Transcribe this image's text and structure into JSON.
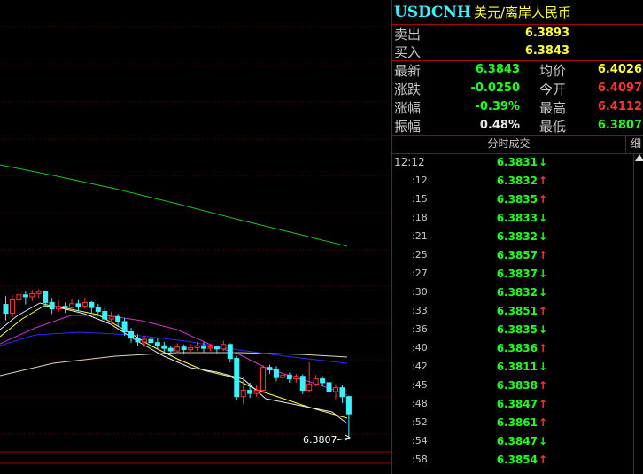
{
  "symbol": "USDCNH",
  "name": "美元/离岸人民币",
  "quote": {
    "sell_label": "卖出",
    "sell_value": "6.3893",
    "buy_label": "买入",
    "buy_value": "6.3843",
    "latest_label": "最新",
    "latest_value": "6.3843",
    "avg_label": "均价",
    "avg_value": "6.4026",
    "change_label": "涨跌",
    "change_value": "-0.0250",
    "open_label": "今开",
    "open_value": "6.4097",
    "pct_label": "涨幅",
    "pct_value": "-0.39%",
    "high_label": "最高",
    "high_value": "6.4112",
    "amp_label": "振幅",
    "amp_value": "0.48%",
    "low_label": "最低",
    "low_value": "6.3807"
  },
  "tabs": {
    "main": "分时成交",
    "side": "细"
  },
  "ticks": [
    {
      "time": "12:12",
      "price": "6.3831",
      "dir": "down"
    },
    {
      "time": ":12",
      "price": "6.3832",
      "dir": "up"
    },
    {
      "time": ":15",
      "price": "6.3835",
      "dir": "up"
    },
    {
      "time": ":18",
      "price": "6.3833",
      "dir": "down"
    },
    {
      "time": ":21",
      "price": "6.3832",
      "dir": "down"
    },
    {
      "time": ":25",
      "price": "6.3857",
      "dir": "up"
    },
    {
      "time": ":27",
      "price": "6.3837",
      "dir": "down"
    },
    {
      "time": ":30",
      "price": "6.3832",
      "dir": "down"
    },
    {
      "time": ":33",
      "price": "6.3851",
      "dir": "up"
    },
    {
      "time": ":36",
      "price": "6.3835",
      "dir": "down"
    },
    {
      "time": ":40",
      "price": "6.3836",
      "dir": "up"
    },
    {
      "time": ":42",
      "price": "6.3811",
      "dir": "down"
    },
    {
      "time": ":45",
      "price": "6.3838",
      "dir": "up"
    },
    {
      "time": ":48",
      "price": "6.3847",
      "dir": "up"
    },
    {
      "time": ":52",
      "price": "6.3861",
      "dir": "up"
    },
    {
      "time": ":54",
      "price": "6.3847",
      "dir": "down"
    },
    {
      "time": ":58",
      "price": "6.3854",
      "dir": "up"
    }
  ],
  "chart": {
    "last_label": "6.3807",
    "colors": {
      "up": "#ff3535",
      "down": "#3cf0ff",
      "ma_white": "#e8e8e8",
      "ma_yellow": "#ffff40",
      "ma_magenta": "#d030d0",
      "ma_blue": "#2a2aff",
      "ma_gray": "#d8d8b8",
      "ma_green": "#20c020"
    }
  },
  "candles": [
    {
      "o": 6.4015,
      "c": 6.4001,
      "h": 6.4028,
      "l": 6.399
    },
    {
      "o": 6.4001,
      "c": 6.4022,
      "h": 6.403,
      "l": 6.3995
    },
    {
      "o": 6.4022,
      "c": 6.403,
      "h": 6.404,
      "l": 6.4012
    },
    {
      "o": 6.403,
      "c": 6.4027,
      "h": 6.4036,
      "l": 6.4015
    },
    {
      "o": 6.4027,
      "c": 6.4032,
      "h": 6.4038,
      "l": 6.402
    },
    {
      "o": 6.4032,
      "c": 6.4035,
      "h": 6.4039,
      "l": 6.4025
    },
    {
      "o": 6.4035,
      "c": 6.4018,
      "h": 6.4037,
      "l": 6.401
    },
    {
      "o": 6.4018,
      "c": 6.4008,
      "h": 6.4025,
      "l": 6.4
    },
    {
      "o": 6.4008,
      "c": 6.4012,
      "h": 6.4022,
      "l": 6.4003
    },
    {
      "o": 6.4012,
      "c": 6.401,
      "h": 6.4018,
      "l": 6.4002
    },
    {
      "o": 6.401,
      "c": 6.4016,
      "h": 6.4024,
      "l": 6.4006
    },
    {
      "o": 6.4016,
      "c": 6.4012,
      "h": 6.4022,
      "l": 6.4004
    },
    {
      "o": 6.4012,
      "c": 6.4018,
      "h": 6.4026,
      "l": 6.4008
    },
    {
      "o": 6.4018,
      "c": 6.401,
      "h": 6.402,
      "l": 6.4
    },
    {
      "o": 6.401,
      "c": 6.4004,
      "h": 6.4016,
      "l": 6.3996
    },
    {
      "o": 6.4004,
      "c": 6.3992,
      "h": 6.401,
      "l": 6.3986
    },
    {
      "o": 6.3992,
      "c": 6.3996,
      "h": 6.4004,
      "l": 6.3986
    },
    {
      "o": 6.3996,
      "c": 6.3988,
      "h": 6.4,
      "l": 6.398
    },
    {
      "o": 6.3988,
      "c": 6.3972,
      "h": 6.3994,
      "l": 6.3966
    },
    {
      "o": 6.3972,
      "c": 6.3962,
      "h": 6.3978,
      "l": 6.3955
    },
    {
      "o": 6.3962,
      "c": 6.3956,
      "h": 6.3968,
      "l": 6.395
    },
    {
      "o": 6.3956,
      "c": 6.396,
      "h": 6.3966,
      "l": 6.3948
    },
    {
      "o": 6.396,
      "c": 6.3955,
      "h": 6.3964,
      "l": 6.3947
    },
    {
      "o": 6.3955,
      "c": 6.395,
      "h": 6.3962,
      "l": 6.3944
    },
    {
      "o": 6.395,
      "c": 6.3946,
      "h": 6.3956,
      "l": 6.394
    },
    {
      "o": 6.3946,
      "c": 6.3942,
      "h": 6.395,
      "l": 6.3936
    },
    {
      "o": 6.3942,
      "c": 6.3948,
      "h": 6.3954,
      "l": 6.3938
    },
    {
      "o": 6.3948,
      "c": 6.3944,
      "h": 6.3952,
      "l": 6.3936
    },
    {
      "o": 6.3944,
      "c": 6.3947,
      "h": 6.3953,
      "l": 6.3938
    },
    {
      "o": 6.3947,
      "c": 6.395,
      "h": 6.3956,
      "l": 6.3942
    },
    {
      "o": 6.395,
      "c": 6.3946,
      "h": 6.3956,
      "l": 6.394
    },
    {
      "o": 6.3946,
      "c": 6.3948,
      "h": 6.3953,
      "l": 6.3942
    },
    {
      "o": 6.3948,
      "c": 6.3945,
      "h": 6.395,
      "l": 6.3938
    },
    {
      "o": 6.3945,
      "c": 6.3952,
      "h": 6.3958,
      "l": 6.3942
    },
    {
      "o": 6.3952,
      "c": 6.393,
      "h": 6.3954,
      "l": 6.3924
    },
    {
      "o": 6.393,
      "c": 6.387,
      "h": 6.3934,
      "l": 6.3865
    },
    {
      "o": 6.387,
      "c": 6.388,
      "h": 6.39,
      "l": 6.3858
    },
    {
      "o": 6.388,
      "c": 6.3875,
      "h": 6.3892,
      "l": 6.3868
    },
    {
      "o": 6.3875,
      "c": 6.388,
      "h": 6.3888,
      "l": 6.387
    },
    {
      "o": 6.388,
      "c": 6.3916,
      "h": 6.392,
      "l": 6.3876
    },
    {
      "o": 6.3916,
      "c": 6.3912,
      "h": 6.392,
      "l": 6.3906
    },
    {
      "o": 6.3912,
      "c": 6.39,
      "h": 6.3918,
      "l": 6.3894
    },
    {
      "o": 6.39,
      "c": 6.3904,
      "h": 6.391,
      "l": 6.389
    },
    {
      "o": 6.3904,
      "c": 6.3898,
      "h": 6.3908,
      "l": 6.3892
    },
    {
      "o": 6.3898,
      "c": 6.3902,
      "h": 6.3906,
      "l": 6.3892
    },
    {
      "o": 6.3902,
      "c": 6.388,
      "h": 6.3905,
      "l": 6.3874
    },
    {
      "o": 6.388,
      "c": 6.389,
      "h": 6.3924,
      "l": 6.3876
    },
    {
      "o": 6.389,
      "c": 6.3898,
      "h": 6.3904,
      "l": 6.3886
    },
    {
      "o": 6.3898,
      "c": 6.3892,
      "h": 6.3902,
      "l": 6.3886
    },
    {
      "o": 6.3892,
      "c": 6.3878,
      "h": 6.3896,
      "l": 6.3872
    },
    {
      "o": 6.3878,
      "c": 6.3884,
      "h": 6.389,
      "l": 6.3866
    },
    {
      "o": 6.3884,
      "c": 6.387,
      "h": 6.3888,
      "l": 6.386
    },
    {
      "o": 6.387,
      "c": 6.3843,
      "h": 6.3872,
      "l": 6.3807
    }
  ]
}
